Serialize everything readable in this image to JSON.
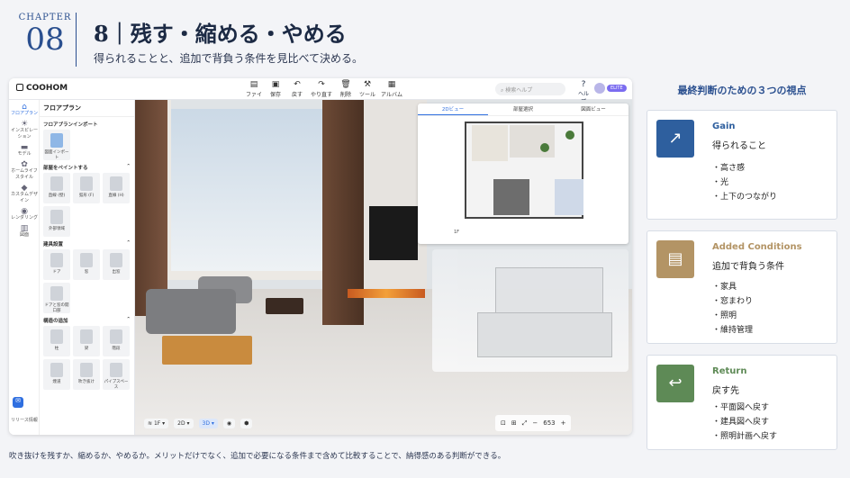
{
  "chapter": {
    "label": "CHAPTER",
    "number": "08"
  },
  "title": "8｜残す・縮める・やめる",
  "subtitle": "得られることと、追加で背負う条件を見比べて決める。",
  "app": {
    "logo": "COOHOM",
    "toolbar": [
      {
        "icon": "file-icon",
        "label": "ファイル"
      },
      {
        "icon": "save-icon",
        "label": "保存"
      },
      {
        "icon": "undo-icon",
        "label": "戻す"
      },
      {
        "icon": "redo-icon",
        "label": "やり直す"
      },
      {
        "icon": "delete-icon",
        "label": "削除"
      },
      {
        "icon": "tool-icon",
        "label": "ツール"
      },
      {
        "icon": "album-icon",
        "label": "アルバム"
      }
    ],
    "search_placeholder": "検索ヘルプ",
    "help_label": "ヘルプ",
    "elite_badge": "ELITE",
    "left_nav": [
      {
        "icon": "floorplan-icon",
        "label": "フロアプラン",
        "active": true
      },
      {
        "icon": "bulb-icon",
        "label": "インスピレーション"
      },
      {
        "icon": "model-icon",
        "label": "モデル"
      },
      {
        "icon": "lifestyle-icon",
        "label": "ホームライフスタイル"
      },
      {
        "icon": "custom-design-icon",
        "label": "カスタムデザイン"
      },
      {
        "icon": "render-icon",
        "label": "レンダリング"
      },
      {
        "icon": "drawing-icon",
        "label": "図面"
      }
    ],
    "release_label": "リリース情報",
    "panel": {
      "title": "フロアプラン",
      "sections": [
        {
          "title": "フロアプランインポート",
          "items": [
            "図面インポート"
          ]
        },
        {
          "title": "部屋をペイントする",
          "items": [
            "直線 (壁)",
            "弧形 (F)",
            "直線 (H)",
            "外部領域"
          ]
        },
        {
          "title": "建具設置",
          "items": [
            "ドア",
            "窓",
            "出窓",
            "ドアと窓の開口部"
          ]
        },
        {
          "title": "構造の追加",
          "items": [
            "柱",
            "梁",
            "階段",
            "煙道",
            "吹き抜け",
            "パイプスペース"
          ]
        }
      ]
    },
    "view_tabs": [
      {
        "label": "2Dビュー",
        "active": true
      },
      {
        "label": "部屋選択",
        "active": false
      },
      {
        "label": "図面ビュー",
        "active": false
      }
    ],
    "floor_label_plan": "1F",
    "bottom_controls": {
      "floor": "1F",
      "view2d": "2D",
      "view3d": "3D"
    },
    "zoom": "653"
  },
  "caption": "吹き抜けを残すか、縮めるか、やめるか。メリットだけでなく、追加で必要になる条件まで含めて比較することで、納得感のある判断ができる。",
  "right": {
    "title": "最終判断のための３つの視点",
    "cards": [
      {
        "icon": "trend-up-icon",
        "color": "#2e5f9e",
        "name": "Gain",
        "name_color": "#2e5f9e",
        "sub": "得られること",
        "items": [
          "高さ感",
          "光",
          "上下のつながり"
        ]
      },
      {
        "icon": "document-icon",
        "color": "#b39465",
        "name": "Added Conditions",
        "name_color": "#b39465",
        "sub": "追加で背負う条件",
        "items": [
          "家具",
          "窓まわり",
          "照明",
          "維持管理"
        ]
      },
      {
        "icon": "return-icon",
        "color": "#5e8a56",
        "name": "Return",
        "name_color": "#5e8a56",
        "sub": "戻す先",
        "items": [
          "平面図へ戻す",
          "建具図へ戻す",
          "照明計画へ戻す"
        ]
      }
    ]
  }
}
